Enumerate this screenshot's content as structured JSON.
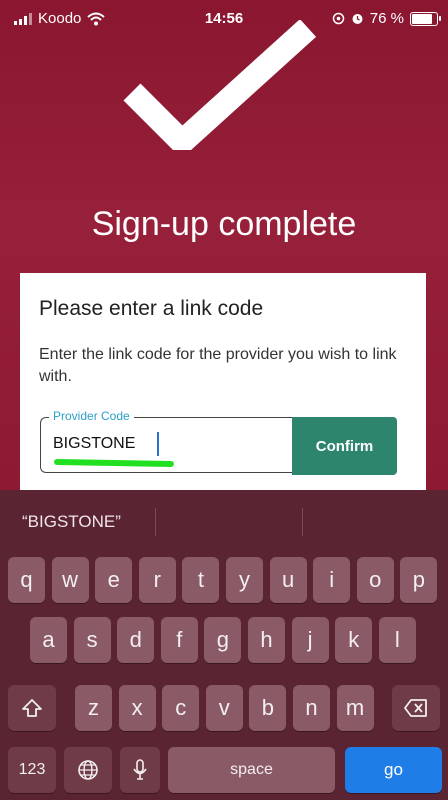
{
  "status_bar": {
    "carrier": "Koodo",
    "time": "14:56",
    "battery": "76 %"
  },
  "page": {
    "title": "Sign-up complete"
  },
  "card": {
    "heading": "Please enter a link code",
    "description": "Enter the link code for the provider you wish to link with.",
    "field_label": "Provider Code",
    "field_value": "BIGSTONE",
    "confirm_label": "Confirm"
  },
  "keyboard": {
    "suggestion": "“BIGSTONE”",
    "row1": [
      "q",
      "w",
      "e",
      "r",
      "t",
      "y",
      "u",
      "i",
      "o",
      "p"
    ],
    "row2": [
      "a",
      "s",
      "d",
      "f",
      "g",
      "h",
      "j",
      "k",
      "l"
    ],
    "row3": [
      "z",
      "x",
      "c",
      "v",
      "b",
      "n",
      "m"
    ],
    "numbers_label": "123",
    "space_label": "space",
    "go_label": "go",
    "icons": {
      "shift": "shift-icon",
      "delete": "backspace-icon",
      "globe": "globe-icon",
      "mic": "microphone-icon"
    }
  },
  "colors": {
    "background": "#8f1a32",
    "confirm": "#2d856e",
    "go": "#1f7de8",
    "label": "#2aa0c9",
    "highlight": "#21e01f"
  }
}
